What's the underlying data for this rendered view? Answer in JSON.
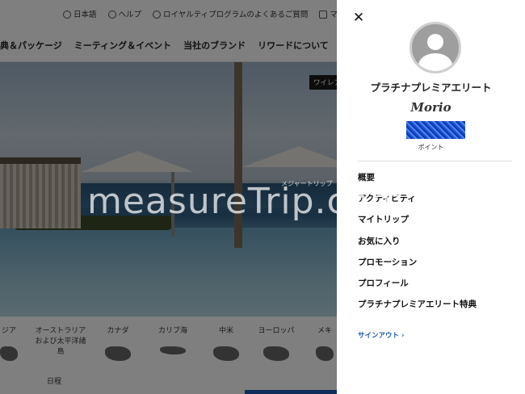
{
  "header": {
    "utility_links": [
      {
        "icon": "globe-icon",
        "label": "日本語"
      },
      {
        "icon": "help-icon",
        "label": "ヘルプ"
      },
      {
        "icon": "info-icon",
        "label": "ロイヤルティプログラムのよくあるご質問"
      },
      {
        "icon": "suitcase-icon",
        "label": "マ"
      }
    ],
    "nav_items": [
      "典＆パッケージ",
      "ミーティング＆イベント",
      "当社のブランド",
      "リワードについて"
    ]
  },
  "hero": {
    "badge": "ワイレア"
  },
  "regions": {
    "items": [
      "ジア",
      "オーストラリアおよび太平洋諸島",
      "カナダ",
      "カリブ海",
      "中米",
      "ヨーロッパ",
      "メキ"
    ],
    "schedule_label": "日程"
  },
  "drawer": {
    "tier": "プラチナプレミアエリート",
    "member_name": "Morio",
    "points_label": "ポイント",
    "menu": [
      "概要",
      "アクティビティ",
      "マイトリップ",
      "お気に入り",
      "プロモーション",
      "プロフィール",
      "プラチナプレミアエリート特典"
    ],
    "signout": "サインアウト ›"
  },
  "watermark": {
    "text": "measureTrip.com",
    "sub": "メジャートリップ"
  },
  "colors": {
    "accent_blue": "#1f5bb0",
    "overlay": "rgba(0,0,0,0.5)"
  }
}
